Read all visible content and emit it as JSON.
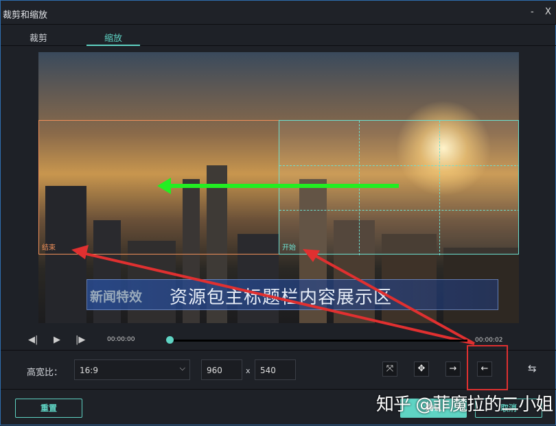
{
  "window": {
    "title": "裁剪和缩放",
    "minimize": "-",
    "close": "X"
  },
  "tabs": [
    {
      "label": "裁剪",
      "active": false
    },
    {
      "label": "缩放",
      "active": true
    }
  ],
  "preview": {
    "end_label": "结束",
    "start_label": "开始",
    "banner_sub": "新闻特效",
    "banner_main": "资源包主标题栏内容展示区"
  },
  "player": {
    "current_time": "00:00:00",
    "end_time": "00:00:02",
    "progress": 0
  },
  "controls": {
    "aspect_label": "高宽比：",
    "aspect_value": "16:9",
    "width": "960",
    "x_sep": "x",
    "height": "540"
  },
  "footer": {
    "reset": "重置",
    "confirm": "确认",
    "cancel": "取消"
  },
  "watermark": "知乎 @菲魔拉的二小姐",
  "colors": {
    "accent": "#5fd4c4",
    "end_box": "#f0905a",
    "annotation": "#e03030",
    "motion_arrow": "#22ee22"
  }
}
